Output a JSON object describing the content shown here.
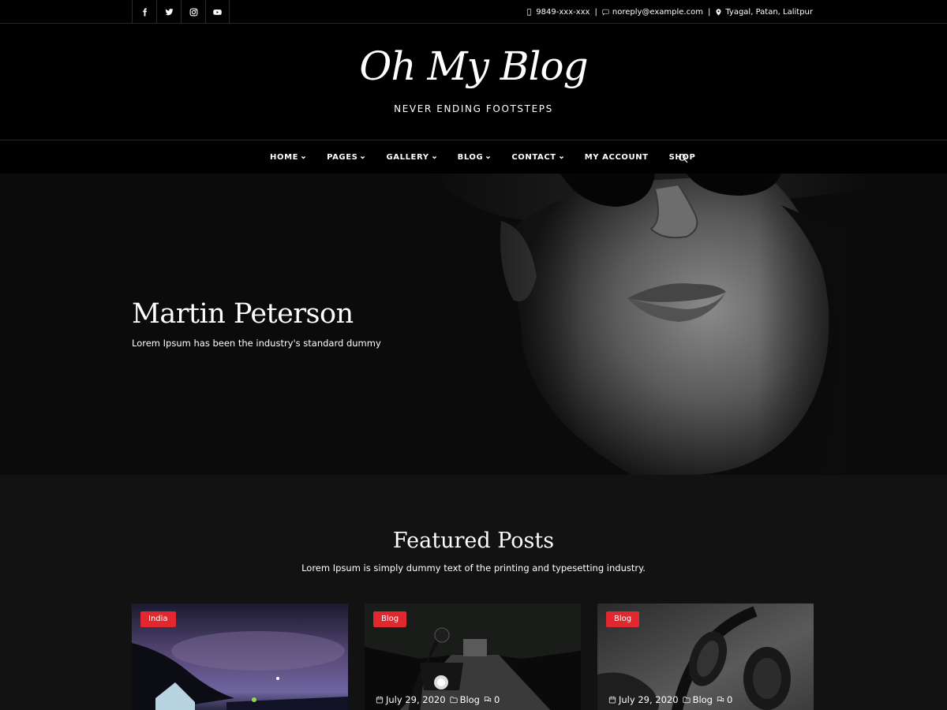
{
  "topbar": {
    "social": [
      {
        "name": "facebook-icon"
      },
      {
        "name": "twitter-icon"
      },
      {
        "name": "instagram-icon"
      },
      {
        "name": "youtube-icon"
      }
    ],
    "phone": "9849-xxx-xxx",
    "email": "noreply@example.com",
    "address": "Tyagal, Patan, Lalitpur"
  },
  "header": {
    "site_title": "Oh My Blog",
    "tagline": "NEVER ENDING FOOTSTEPS"
  },
  "nav": {
    "items": [
      {
        "label": "HOME",
        "dropdown": true
      },
      {
        "label": "PAGES",
        "dropdown": true
      },
      {
        "label": "GALLERY",
        "dropdown": true
      },
      {
        "label": "BLOG",
        "dropdown": true
      },
      {
        "label": "CONTACT",
        "dropdown": true
      },
      {
        "label": "MY ACCOUNT",
        "dropdown": false
      },
      {
        "label": "SHOP",
        "dropdown": false
      }
    ],
    "search_icon": "search-icon"
  },
  "hero": {
    "title": "Martin Peterson",
    "text": "Lorem Ipsum has been the industry's standard dummy"
  },
  "featured": {
    "title": "Featured Posts",
    "subtitle": "Lorem Ipsum is simply dummy text of the printing and typesetting industry.",
    "posts": [
      {
        "category": "India",
        "date": "",
        "folder": "",
        "comments": ""
      },
      {
        "category": "Blog",
        "date": "July 29, 2020",
        "folder": "Blog",
        "comments": "0"
      },
      {
        "category": "Blog",
        "date": "July 29, 2020",
        "folder": "Blog",
        "comments": "0"
      }
    ]
  },
  "colors": {
    "accent": "#e0282e",
    "background": "#000000",
    "section_bg": "#121212"
  }
}
